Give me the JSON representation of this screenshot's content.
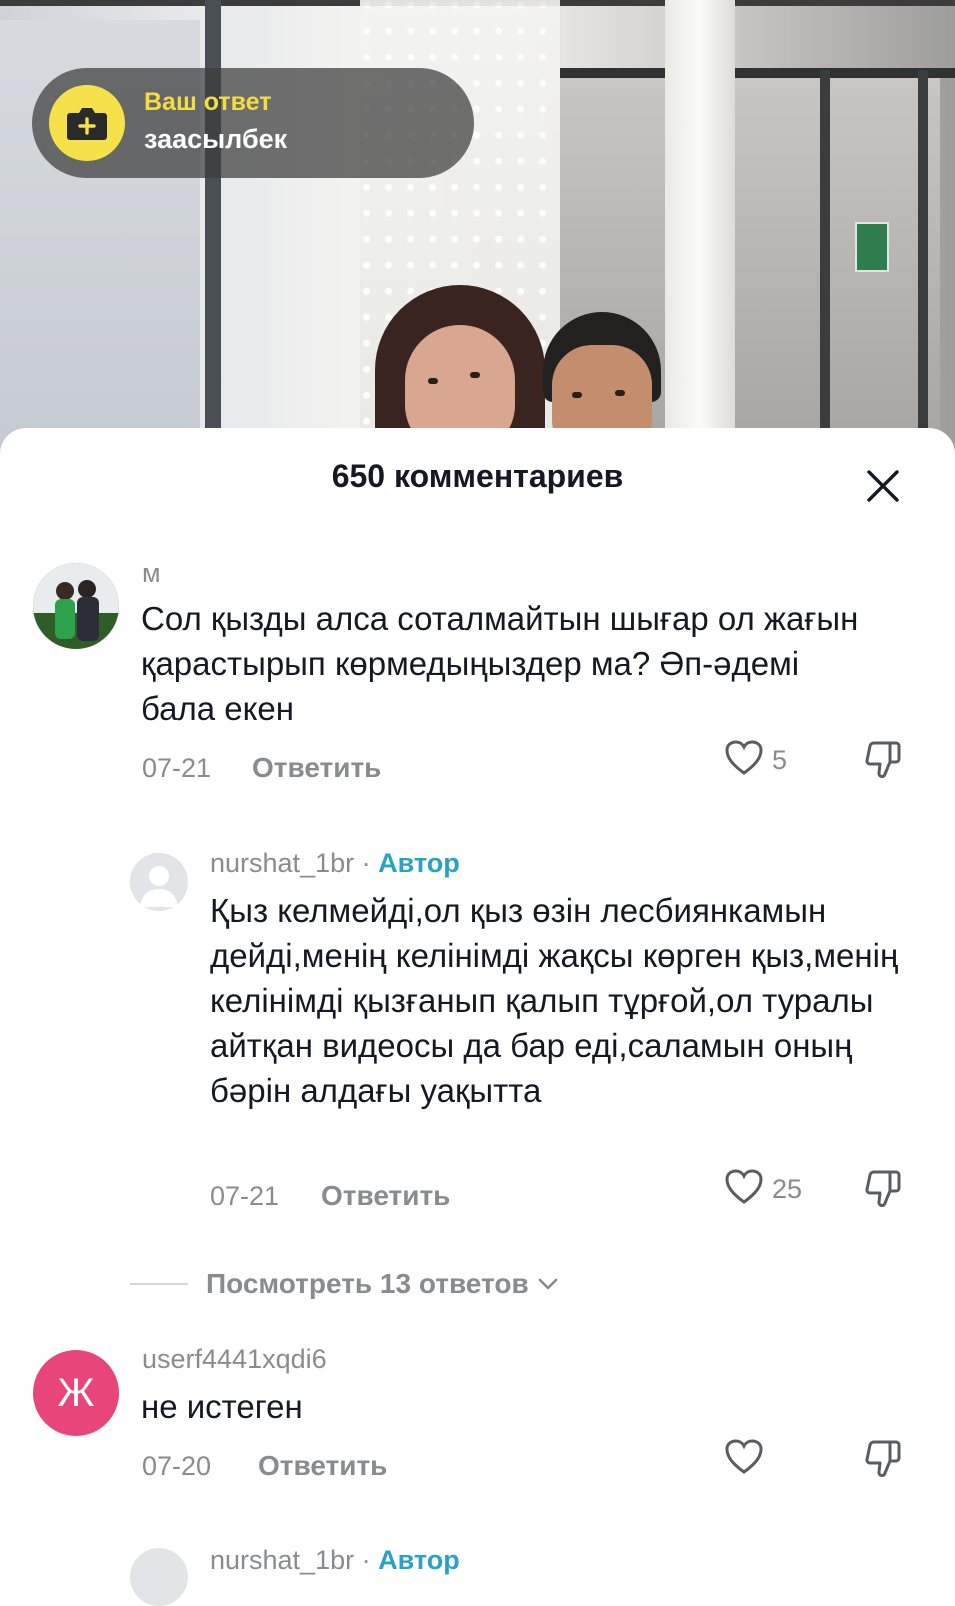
{
  "answer_pill": {
    "title": "Ваш ответ",
    "username": "заасылбек",
    "icon": "add-icon"
  },
  "comments_sheet": {
    "title": "650 комментариев",
    "close_icon": "close-icon"
  },
  "comments": [
    {
      "username": "м",
      "text": "Сол қызды алса соталмайтын шығар ол жағын қарастырып көрмедыңыздер ма? Әп-әдемі бала екен",
      "date": "07-21",
      "reply_label": "Ответить",
      "likes": "5"
    },
    {
      "username": "nurshat_1br",
      "author_separator": " · ",
      "author_tag": "Автор",
      "text": "Қыз келмейді,ол қыз өзін лесбиянкамын дейді,менің келінімді жақсы көрген қыз,менің келінімді қызғанып қалып тұрғой,ол туралы айтқан видеосы да бар еді,саламын оның бәрін алдағы уақытта",
      "date": "07-21",
      "reply_label": "Ответить",
      "likes": "25"
    },
    {
      "username": "userf4441xqdi6",
      "avatar_letter": "Ж",
      "text": "не истеген",
      "date": "07-20",
      "reply_label": "Ответить",
      "likes": ""
    },
    {
      "username": "nurshat_1br",
      "author_separator": " · ",
      "author_tag": "Автор"
    }
  ],
  "view_replies": {
    "label": "Посмотреть 13 ответов"
  },
  "colors": {
    "accent_author": "#2aa2c7",
    "pill_icon_bg": "#f5e14a",
    "pill_title": "#f3dd43",
    "avatar_letter_bg": "#e8457a"
  }
}
